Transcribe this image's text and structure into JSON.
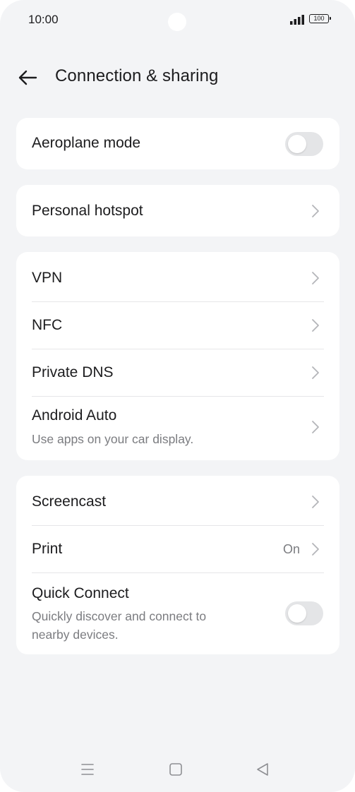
{
  "status": {
    "time": "10:00",
    "battery": "100"
  },
  "header": {
    "title": "Connection & sharing"
  },
  "cards": {
    "aeroplane": {
      "label": "Aeroplane mode",
      "toggle_on": false
    },
    "hotspot": {
      "label": "Personal hotspot"
    },
    "network": {
      "vpn": "VPN",
      "nfc": "NFC",
      "private_dns": "Private DNS",
      "android_auto": "Android Auto",
      "android_auto_sub": "Use apps on your car display."
    },
    "other": {
      "screencast": "Screencast",
      "print": "Print",
      "print_value": "On",
      "quick_connect": "Quick Connect",
      "quick_connect_sub_1": "Quickly discover and connect to",
      "quick_connect_sub_2": "nearby devices.",
      "quick_connect_toggle_on": false
    }
  },
  "icons": {
    "back": "arrow-left-icon",
    "chevron": "chevron-right-icon",
    "nav_recents": "menu-lines-icon",
    "nav_home": "square-icon",
    "nav_back": "triangle-left-icon"
  },
  "colors": {
    "background": "#f3f4f6",
    "card": "#ffffff",
    "primary_text": "#1c1c1e",
    "secondary_text": "#7b7c80",
    "toggle_off": "#e4e5e7",
    "chevron": "#b4b5b9"
  }
}
